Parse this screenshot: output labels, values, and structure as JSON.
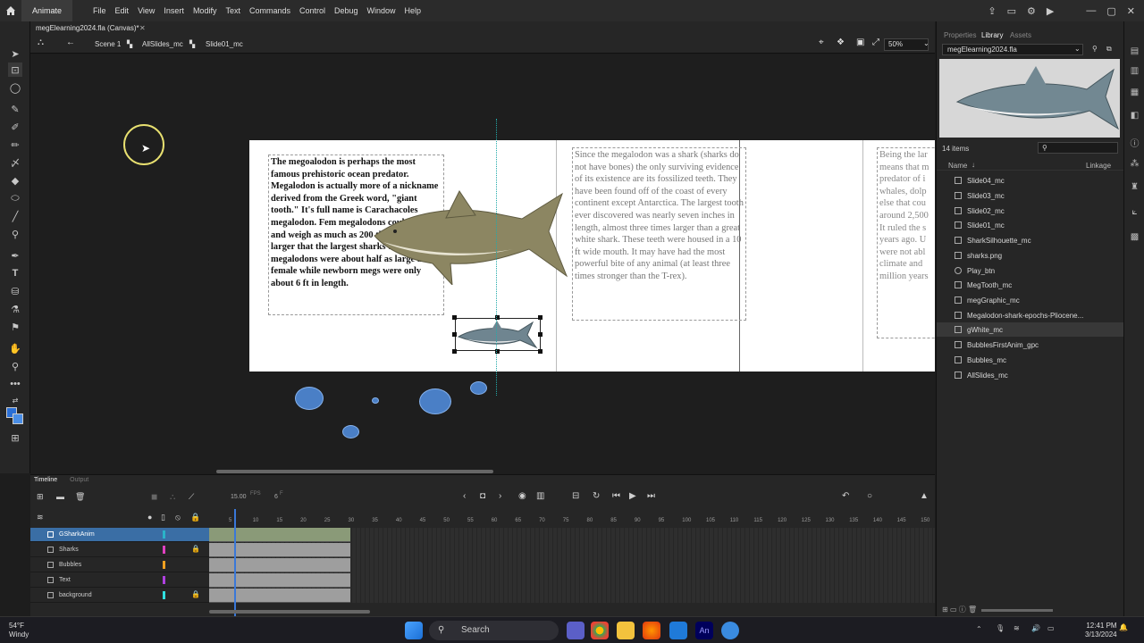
{
  "menubar": {
    "app_name": "Animate",
    "menus": [
      "File",
      "Edit",
      "View",
      "Insert",
      "Modify",
      "Text",
      "Commands",
      "Control",
      "Debug",
      "Window",
      "Help"
    ]
  },
  "document": {
    "tab_title": "megElearning2024.fla (Canvas)*",
    "breadcrumbs": [
      "Scene 1",
      "AllSlides_mc",
      "Slide01_mc"
    ],
    "zoom": "50%"
  },
  "stage": {
    "slide1_text": "The megoalodon is perhaps the most famous prehistoric ocean predator. Megalodon is actually more of a nickname derived from the Greek word, \"giant tooth.\" It's full name is Carachacoles megalodon. Fem megalodons could reach and weigh as much as 200 three times larger that the largest sharks today. Male megalodons were about half as large as female while newborn megs were only about 6 ft in length.",
    "slide2_text": "Since the megalodon was a shark (sharks do not have bones) the only surviving evidence of its existence are its fossilized teeth. They have been found off of the coast of every continent except Antarctica. The largest tooth ever discovered was nearly seven inches in length, almost three times larger than a great white shark. These teeth were housed in a 10 ft wide mouth. It may have had the most powerful bite of any animal (at least three times stronger than the T-rex).",
    "slide3_text": "Being the lar\nmeans that m\npredator of i\nwhales, dolp\nelse that cou\naround 2,500\nIt ruled the s\nyears ago. U\nwere not abl\nclimate and\nmillion years"
  },
  "library": {
    "tabs": [
      "Properties",
      "Library",
      "Assets"
    ],
    "selected_file": "megElearning2024.fla",
    "item_count": "14 items",
    "col_name": "Name",
    "col_linkage": "Linkage",
    "items": [
      "Slide04_mc",
      "Slide03_mc",
      "Slide02_mc",
      "Slide01_mc",
      "SharkSilhouette_mc",
      "sharks.png",
      "Play_btn",
      "MegTooth_mc",
      "megGraphic_mc",
      "Megalodon-shark-epochs-Pliocene...",
      "gWhite_mc",
      "BubblesFirstAnim_gpc",
      "Bubbles_mc",
      "AllSlides_mc"
    ],
    "selected_item": "gWhite_mc"
  },
  "timeline": {
    "tabs": [
      "Timeline",
      "Output"
    ],
    "fps": "15.00",
    "fps_unit": "FPS",
    "frame": "6",
    "frame_unit": "F",
    "ruler_ticks": [
      "5",
      "10",
      "15",
      "20",
      "25",
      "30",
      "35",
      "40",
      "45",
      "50",
      "55",
      "60",
      "65",
      "70",
      "75",
      "80",
      "85",
      "90",
      "95",
      "100",
      "105",
      "110",
      "115",
      "120",
      "125",
      "130",
      "135",
      "140",
      "145",
      "150"
    ],
    "layers": [
      {
        "name": "GSharkAnim",
        "color": "#2ab3c9",
        "locked": false
      },
      {
        "name": "Sharks",
        "color": "#e040c0",
        "locked": true
      },
      {
        "name": "Bubbles",
        "color": "#f0a020",
        "locked": false
      },
      {
        "name": "Text",
        "color": "#b040e0",
        "locked": false
      },
      {
        "name": "background",
        "color": "#30e0e0",
        "locked": true
      }
    ]
  },
  "taskbar": {
    "temp": "54°F",
    "weather": "Windy",
    "search": "Search",
    "time": "12:41 PM",
    "date": "3/13/2024"
  }
}
